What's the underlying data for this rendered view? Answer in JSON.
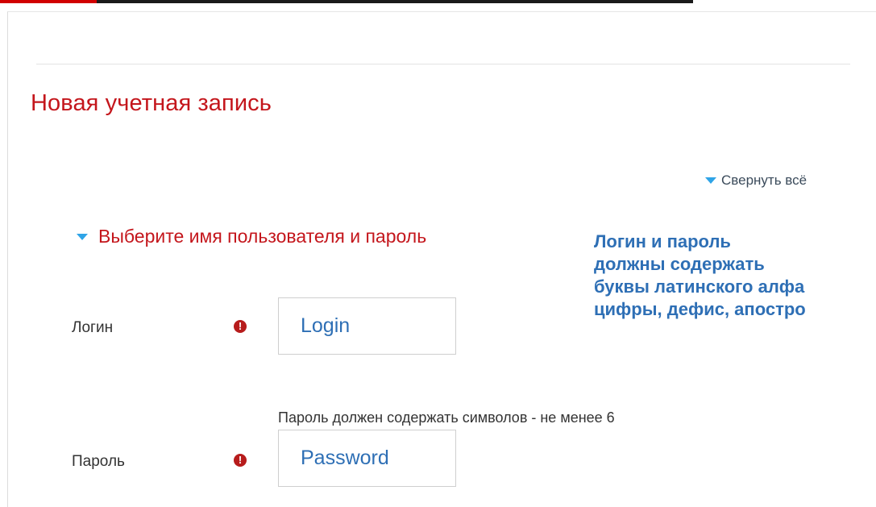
{
  "form": {
    "title": "Новая учетная запись",
    "collapse_all": "Свернуть всё",
    "section": {
      "title": "Выберите имя пользователя и пароль"
    },
    "hint_lines": [
      "Логин и пароль",
      "должны содержать",
      "буквы латинского алфа",
      "цифры, дефис, апостро"
    ],
    "fields": {
      "login": {
        "label": "Логин",
        "value": "Login"
      },
      "password": {
        "label": "Пароль",
        "value": "Password",
        "help": "Пароль должен содержать символов - не менее 6"
      }
    },
    "required_icon": "exclamation-circle-icon"
  },
  "colors": {
    "title_red": "#c4161c",
    "accent_blue": "#2fa4e7",
    "hint_blue": "#2e6fb5",
    "required_red": "#b71c1c"
  }
}
